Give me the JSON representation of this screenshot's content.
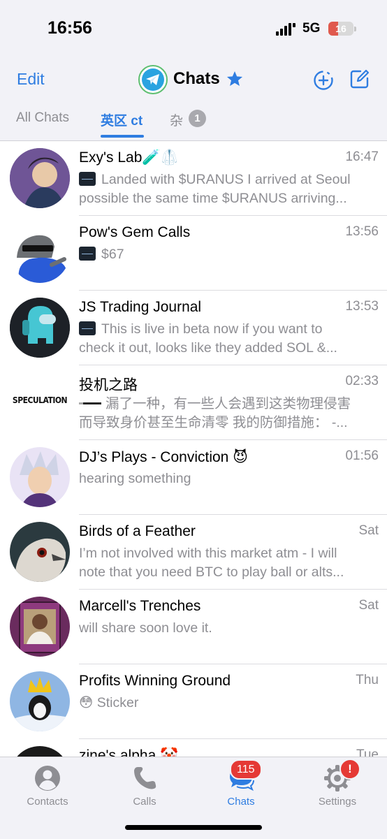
{
  "status": {
    "time": "16:56",
    "network": "5G",
    "battery": "16",
    "battery_color": "#e05a4e"
  },
  "header": {
    "edit": "Edit",
    "title": "Chats"
  },
  "tabs": [
    {
      "label": "All Chats"
    },
    {
      "label": "英区 ct"
    },
    {
      "label": "杂",
      "badge": "1"
    }
  ],
  "chats": [
    {
      "name": "Exy's Lab🧪🥼",
      "time": "16:47",
      "line1": "Landed with $URANUS I arrived at Seoul",
      "line2": "possible the same time $URANUS arriving...",
      "avatar": "cowboy-avatar"
    },
    {
      "name": "Pow's Gem Calls",
      "time": "13:56",
      "line1": "$67",
      "line2": "",
      "avatar": "pepe-sunglasses-avatar"
    },
    {
      "name": "JS Trading Journal",
      "time": "13:53",
      "line1": "This is live in beta now if you want to",
      "line2": "check it out, looks like they added SOL &...",
      "avatar": "among-us-avatar"
    },
    {
      "name": "投机之路",
      "time": "02:33",
      "line1": "漏了一种，有一些人会遇到这类物理侵害",
      "line2": "而导致身价甚至生命清零 我的防御措施： -...",
      "avatar": "speculation-avatar",
      "avatar_text": "SPECULATION"
    },
    {
      "name": "DJ’s Plays - Conviction 😈",
      "time": "01:56",
      "line1": "hearing something",
      "line2": "",
      "avatar": "anime-avatar"
    },
    {
      "name": "Birds of a Feather",
      "time": "Sat",
      "line1": "I’m not involved with this market atm - I will",
      "line2": "note that you need BTC to play ball or alts...",
      "avatar": "bird-avatar"
    },
    {
      "name": "Marcell's Trenches",
      "time": "Sat",
      "line1": "will share soon love it.",
      "line2": "",
      "avatar": "card-avatar"
    },
    {
      "name": "Profits Winning Ground",
      "time": "Thu",
      "line1": "😳 Sticker",
      "line2": "",
      "avatar": "crown-penguin-avatar"
    },
    {
      "name": "zine's alpha 🤡",
      "time": "Tue",
      "line1": "",
      "line2": "",
      "avatar": "dark-avatar"
    }
  ],
  "tabbar": {
    "contacts": "Contacts",
    "calls": "Calls",
    "chats": "Chats",
    "chats_badge": "115",
    "settings": "Settings",
    "settings_badge": "!"
  },
  "colors": {
    "accent": "#2f7de1",
    "badge": "#e53935"
  }
}
